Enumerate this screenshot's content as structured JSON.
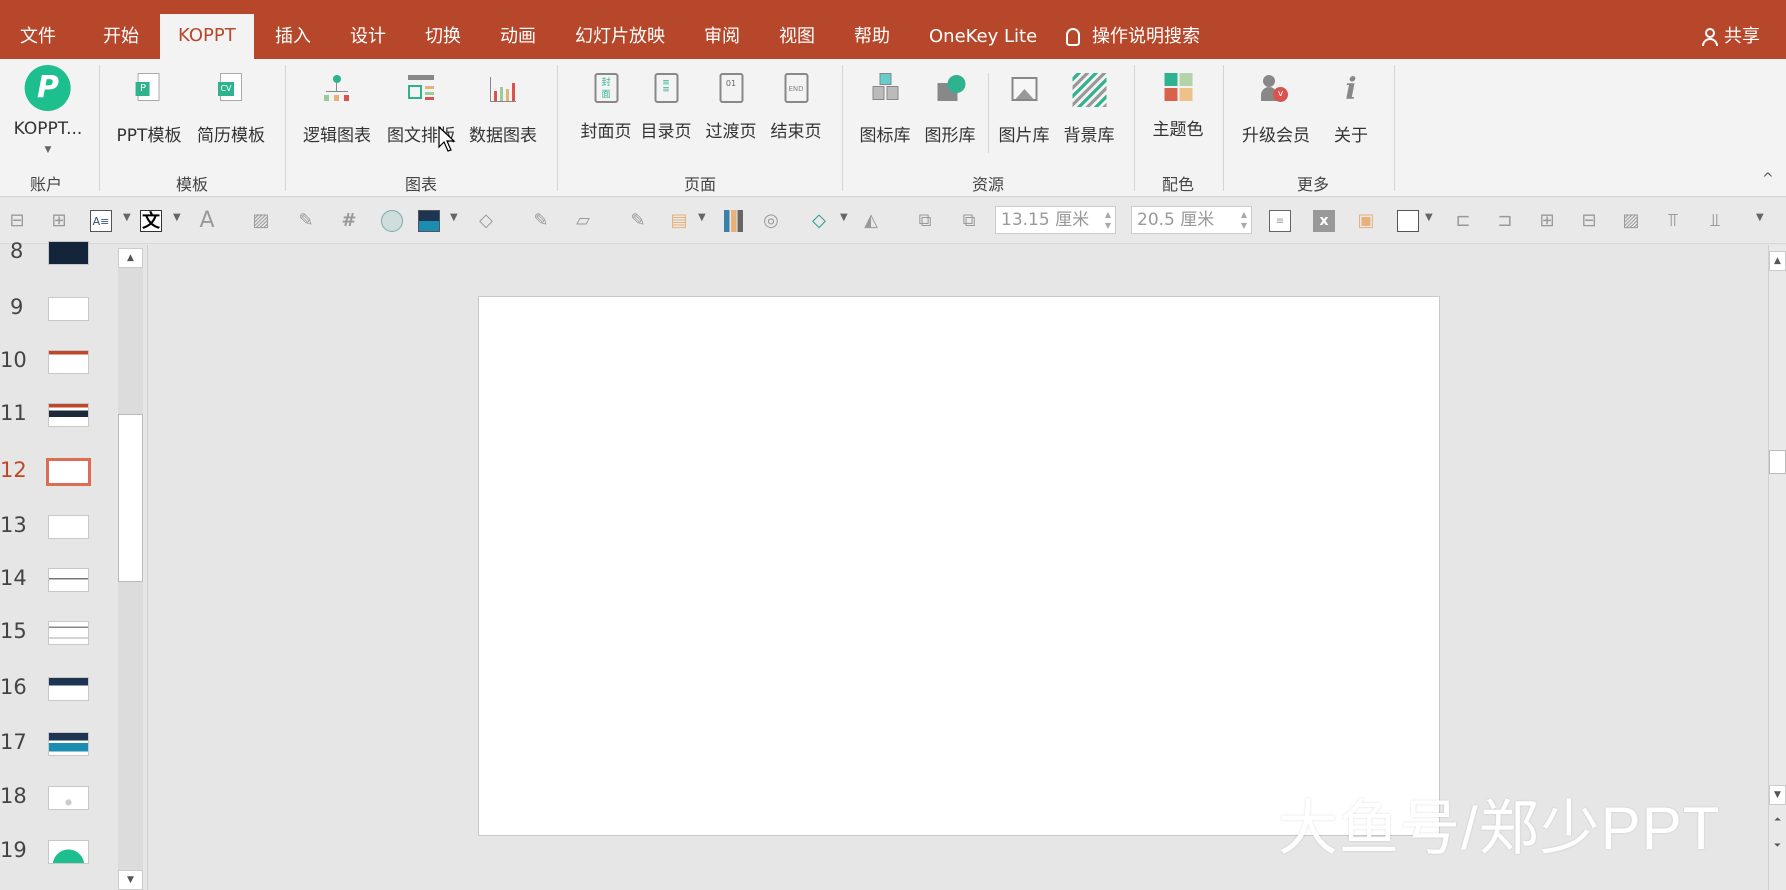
{
  "tabs": [
    "文件",
    "开始",
    "KOPPT",
    "插入",
    "设计",
    "切换",
    "动画",
    "幻灯片放映",
    "审阅",
    "视图",
    "帮助",
    "OneKey Lite"
  ],
  "active_tab": "KOPPT",
  "search_label": "操作说明搜索",
  "share_label": "共享",
  "ribbon": {
    "account": {
      "button": "KOPPT...",
      "group": "账户"
    },
    "template": {
      "buttons": [
        "PPT模板",
        "简历模板"
      ],
      "group": "模板"
    },
    "chart": {
      "buttons": [
        "逻辑图表",
        "图文排版",
        "数据图表"
      ],
      "group": "图表"
    },
    "page": {
      "buttons": [
        "封面页",
        "目录页",
        "过渡页",
        "结束页"
      ],
      "group": "页面"
    },
    "resource": {
      "buttons": [
        "图标库",
        "图形库",
        "图片库",
        "背景库"
      ],
      "group": "资源"
    },
    "color": {
      "buttons": [
        "主题色"
      ],
      "group": "配色"
    },
    "more": {
      "buttons": [
        "升级会员",
        "关于"
      ],
      "group": "更多"
    }
  },
  "toolbar": {
    "height_value": "13.15 厘米",
    "width_value": "20.5 厘米",
    "text_icon": "文",
    "font_icon": "A"
  },
  "slides": [
    "8",
    "9",
    "10",
    "11",
    "12",
    "13",
    "14",
    "15",
    "16",
    "17",
    "18",
    "19"
  ],
  "selected_slide": "12",
  "watermark": "大鱼号/郑少PPT",
  "colors": {
    "accent": "#b7472a",
    "brand_green": "#1dbf8f",
    "selected_border": "#dc6d52"
  }
}
